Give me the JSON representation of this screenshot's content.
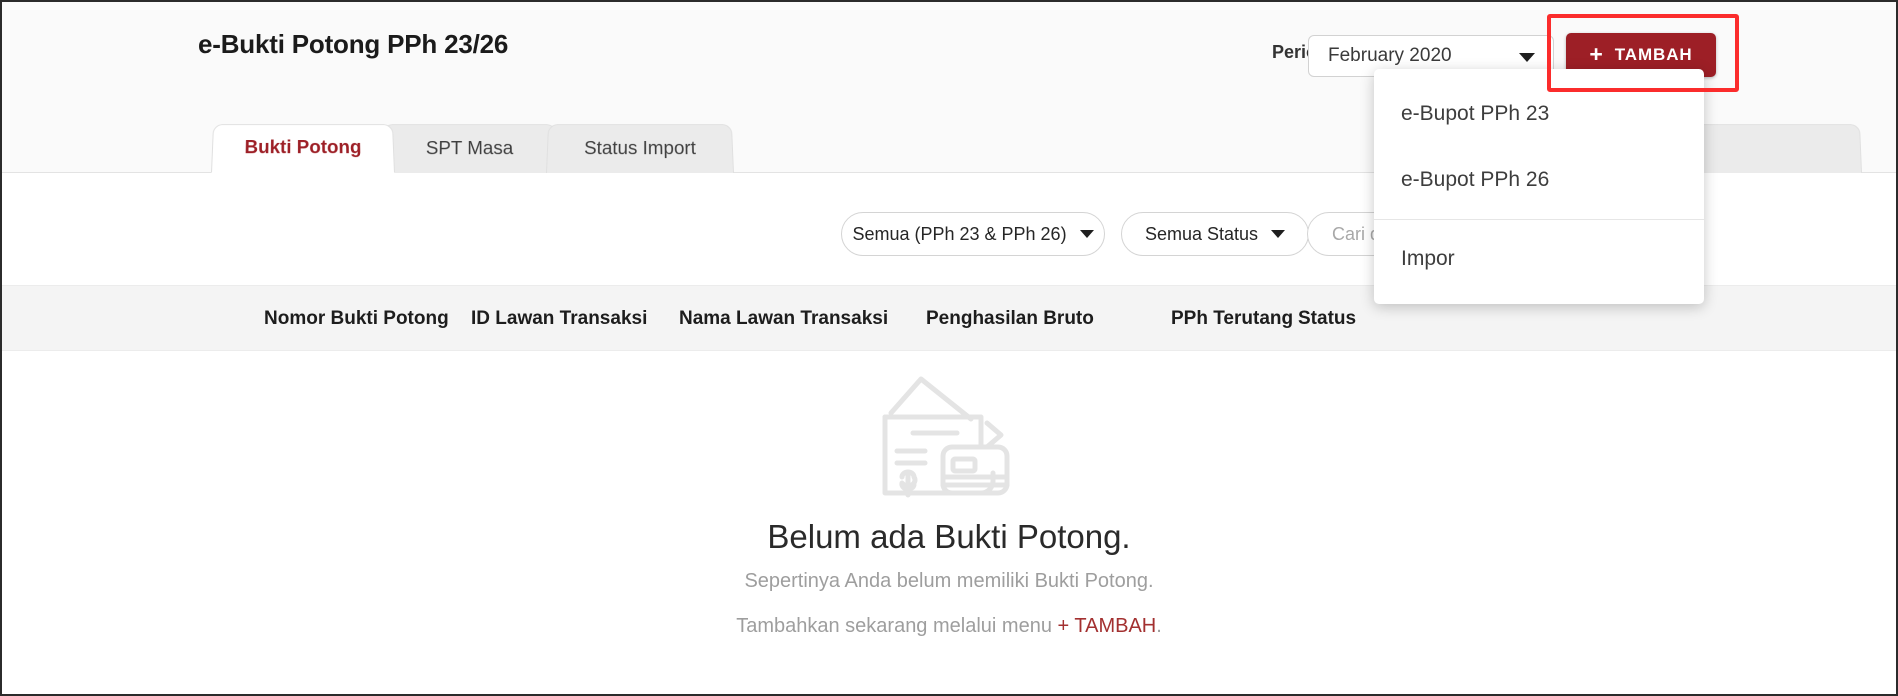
{
  "header": {
    "title": "e-Bukti Potong PPh 23/26",
    "periode_label": "Periode",
    "periode_value": "February  2020",
    "periode_caret_icon": "chevron-down-icon",
    "add_button_label": "TAMBAH",
    "add_button_plus": "+",
    "brand_color": "#9d1f26",
    "highlight_color": "#fb2c2c"
  },
  "tabs": [
    {
      "label": "Bukti Potong",
      "active": true
    },
    {
      "label": "SPT Masa",
      "active": false
    },
    {
      "label": "Status Import",
      "active": false
    }
  ],
  "filters": {
    "jenis": {
      "label": "Semua (PPh 23 & PPh 26)",
      "caret_icon": "chevron-down-icon"
    },
    "status": {
      "label": "Semua Status",
      "caret_icon": "chevron-down-icon"
    },
    "search": {
      "value": "",
      "placeholder": "Cari d"
    }
  },
  "table": {
    "columns": [
      "Nomor Bukti Potong",
      "ID Lawan Transaksi",
      "Nama Lawan Transaksi",
      "Penghasilan Bruto",
      "PPh Terutang",
      "Status"
    ],
    "rows": []
  },
  "empty_state": {
    "illustration_icon": "wallet-card-icon",
    "title": "Belum ada Bukti Potong.",
    "subtitle": "Sepertinya Anda belum memiliki Bukti Potong.",
    "cta_prefix": "Tambahkan sekarang melalui menu ",
    "cta_link": "+ TAMBAH",
    "cta_suffix": "."
  },
  "dropdown": {
    "items": [
      {
        "label": "e-Bupot PPh 23"
      },
      {
        "label": "e-Bupot PPh 26"
      },
      {
        "label": "Impor"
      }
    ],
    "divider_after_index": 1
  }
}
